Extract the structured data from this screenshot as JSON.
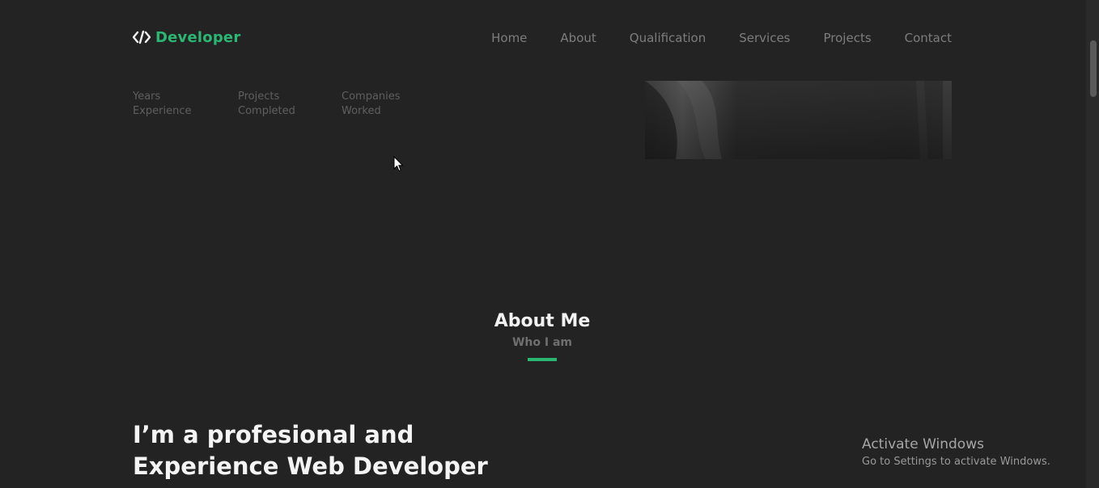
{
  "header": {
    "logo_text": "Developer",
    "logo_icon": "code-brackets-icon",
    "nav": [
      {
        "label": "Home"
      },
      {
        "label": "About"
      },
      {
        "label": "Qualification"
      },
      {
        "label": "Services"
      },
      {
        "label": "Projects"
      },
      {
        "label": "Contact"
      }
    ]
  },
  "stats": [
    {
      "line1": "Years",
      "line2": "Experience"
    },
    {
      "line1": "Projects",
      "line2": "Completed"
    },
    {
      "line1": "Companies",
      "line2": "Worked"
    }
  ],
  "about": {
    "title": "About Me",
    "subtitle": "Who I am",
    "headline_line1": "I’m a profesional and",
    "headline_line2": "Experience Web Developer"
  },
  "watermark": {
    "title": "Activate Windows",
    "subtitle": "Go to Settings to activate Windows."
  },
  "colors": {
    "background": "#232323",
    "accent": "#2bb673",
    "nav_text": "#7d7d7d",
    "heading": "#f2f2f2"
  }
}
